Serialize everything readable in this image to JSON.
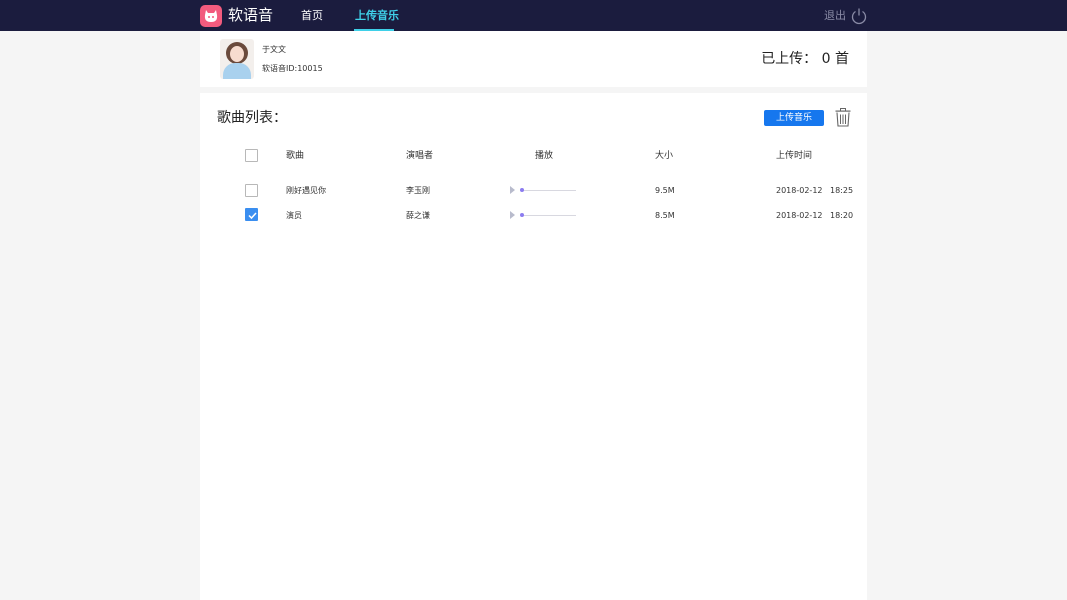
{
  "header": {
    "brand": "软语音",
    "nav": [
      {
        "label": "首页",
        "active": false
      },
      {
        "label": "上传音乐",
        "active": true
      }
    ],
    "logout_label": "退出",
    "colors": {
      "background": "#1b1c3e",
      "active": "#3fd0e8",
      "logo": "#f25b7e"
    }
  },
  "profile": {
    "name": "于文文",
    "id_text": "软语音ID:10015",
    "uploaded_text": "已上传：  0 首"
  },
  "song_list": {
    "title": "歌曲列表：",
    "upload_button": "上传音乐",
    "columns": [
      "歌曲",
      "演唱者",
      "播放",
      "大小",
      "上传时间"
    ],
    "rows": [
      {
        "title": "刚好遇见你",
        "artist": "李玉刚",
        "size": "9.5M",
        "date": "2018-02-12",
        "time": "18:25",
        "checked": false
      },
      {
        "title": "演员",
        "artist": "薛之谦",
        "size": "8.5M",
        "date": "2018-02-12",
        "time": "18:20",
        "checked": true
      }
    ]
  }
}
